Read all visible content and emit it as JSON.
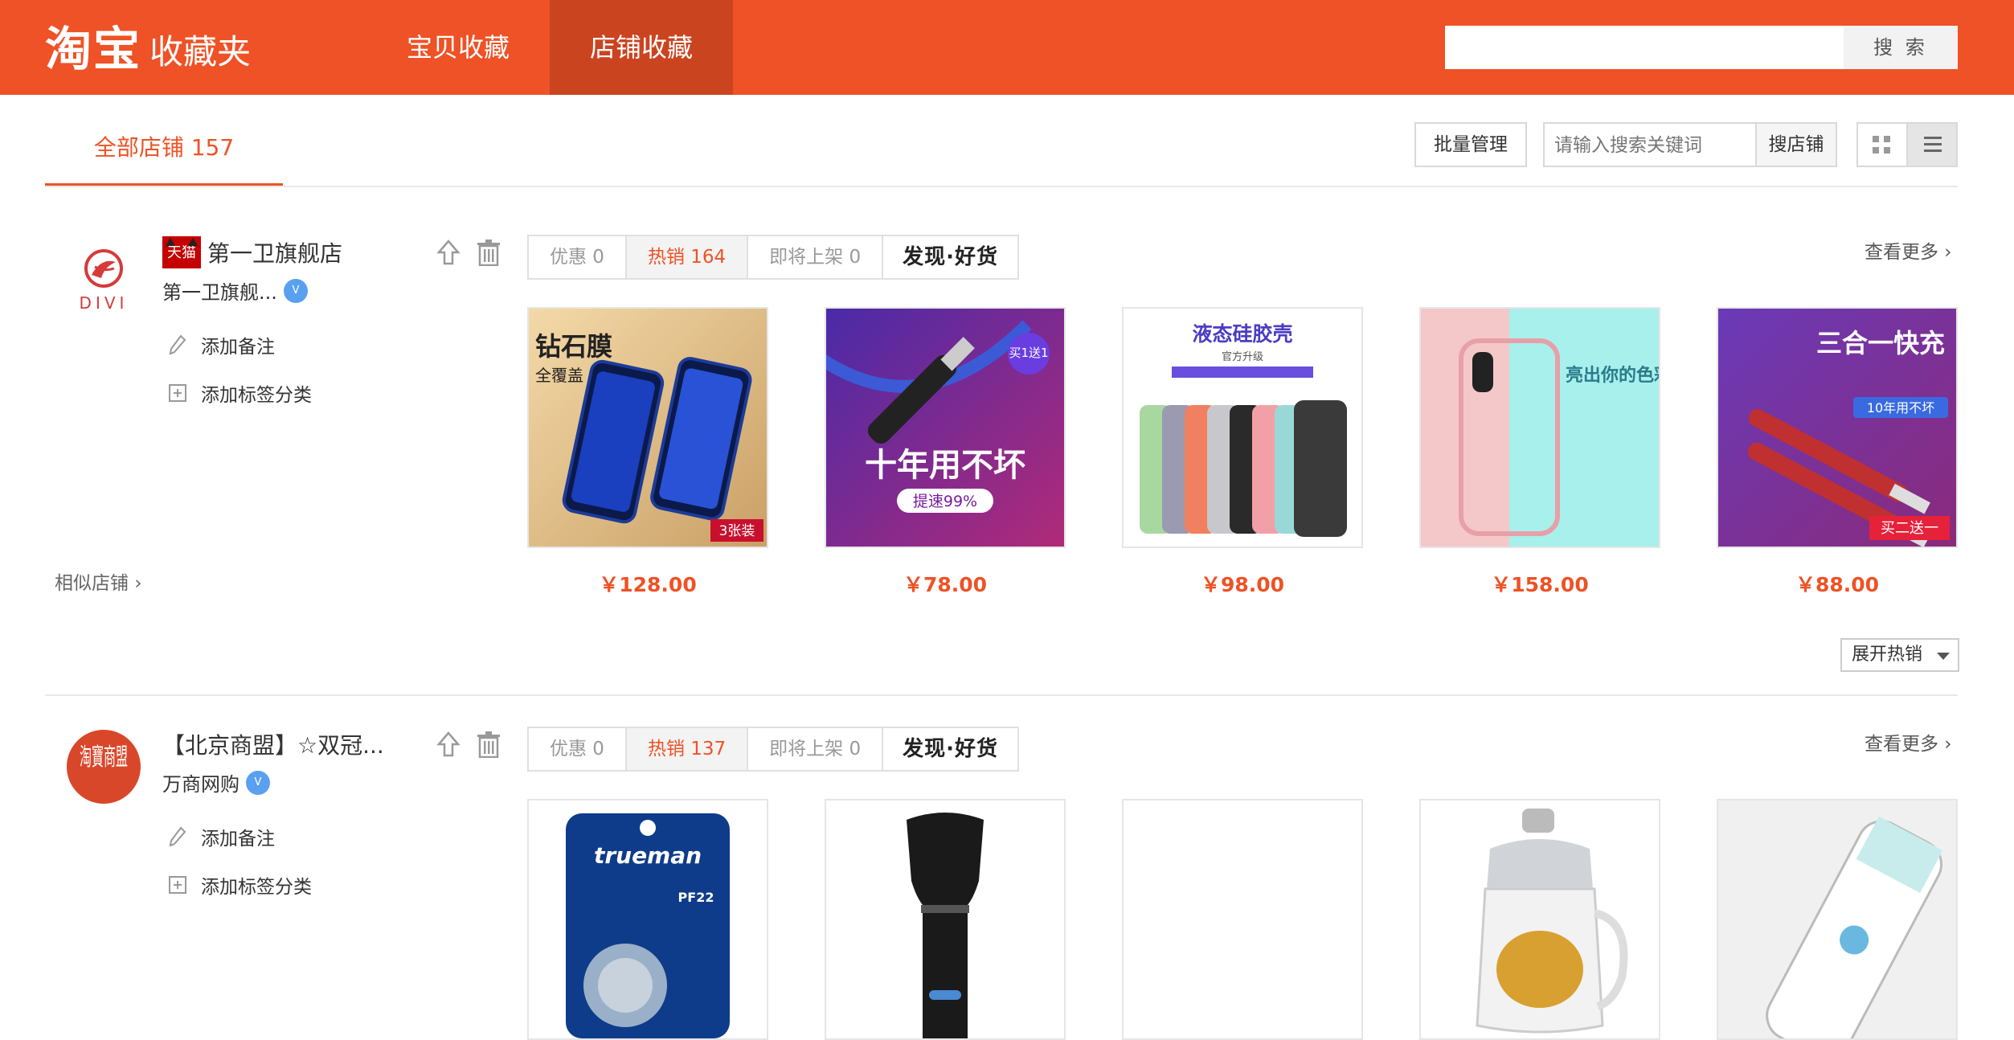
{
  "header": {
    "brand": "淘宝",
    "subtitle": "收藏夹",
    "tabs": [
      {
        "label": "宝贝收藏"
      },
      {
        "label": "店铺收藏"
      }
    ],
    "search_button": "搜 索",
    "search_value": ""
  },
  "toolbar": {
    "all_shops_label": "全部店铺 157",
    "batch_manage": "批量管理",
    "keyword_placeholder": "请输入搜索关键词",
    "search_shops": "搜店铺"
  },
  "stores": [
    {
      "name": "第一卫旗舰店",
      "badge": "天猫",
      "owner": "第一卫旗舰...",
      "logo_text": "DIVI",
      "add_note": "添加备注",
      "add_tag": "添加标签分类",
      "similar": "相似店铺",
      "filters": {
        "discount": "优惠 0",
        "hot": "热销 164",
        "upcoming": "即将上架 0",
        "discover": "发现·好货"
      },
      "more": "查看更多",
      "expand": "展开热销",
      "products": [
        {
          "price": "￥128.00",
          "img_caption": "钻石膜",
          "img_sub": "全覆盖",
          "tag": "3张装"
        },
        {
          "price": "￥78.00",
          "img_caption": "十年用不坏",
          "img_sub": "提速99%",
          "tag": "买1送1"
        },
        {
          "price": "￥98.00",
          "img_caption": "液态硅胶壳",
          "img_sub": "官方升级",
          "tag": ""
        },
        {
          "price": "￥158.00",
          "img_caption": "亮出你的色彩。",
          "img_sub": "",
          "tag": ""
        },
        {
          "price": "￥88.00",
          "img_caption": "三合一快充",
          "img_sub": "10年用不坏",
          "tag": "买二送一"
        }
      ]
    },
    {
      "name": "【北京商盟】☆双冠...",
      "owner": "万商网购",
      "logo_text": "淘寶商盟",
      "add_note": "添加备注",
      "add_tag": "添加标签分类",
      "filters": {
        "discount": "优惠 0",
        "hot": "热销 137",
        "upcoming": "即将上架 0",
        "discover": "发现·好货"
      },
      "more": "查看更多",
      "products": [
        {
          "img_caption": "trueman",
          "img_sub": "PF22"
        },
        {
          "img_caption": ""
        },
        {
          "img_caption": ""
        },
        {
          "img_caption": ""
        },
        {
          "img_caption": ""
        }
      ]
    }
  ],
  "colors": {
    "accent": "#ee5226",
    "accent_dark": "#cb4420"
  },
  "view_mode": "list"
}
